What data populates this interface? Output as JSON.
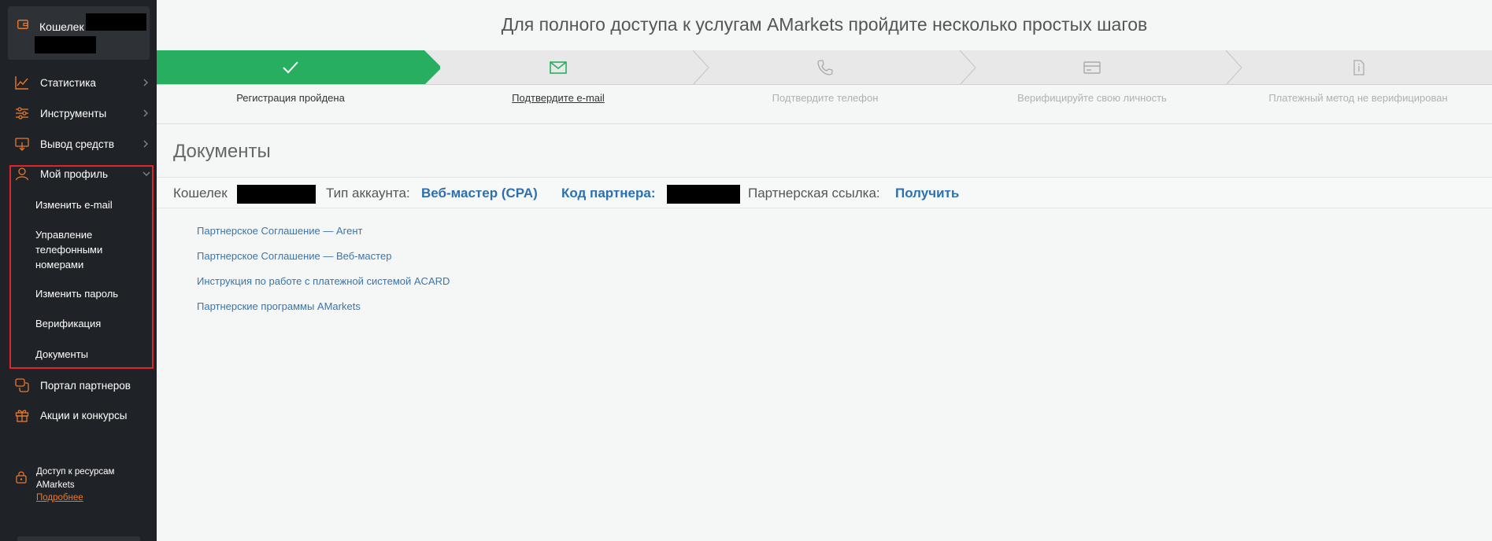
{
  "sidebar": {
    "wallet_label": "Кошелек",
    "items": [
      {
        "label": "Статистика",
        "icon": "chart-icon"
      },
      {
        "label": "Инструменты",
        "icon": "sliders-icon"
      },
      {
        "label": "Вывод средств",
        "icon": "withdraw-icon"
      },
      {
        "label": "Мой профиль",
        "icon": "user-icon"
      },
      {
        "label": "Портал партнеров",
        "icon": "chat-icon"
      },
      {
        "label": "Акции и конкурсы",
        "icon": "gift-icon"
      }
    ],
    "profile_submenu": [
      "Изменить e-mail",
      "Управление телефонными номерами",
      "Изменить пароль",
      "Верификация",
      "Документы"
    ],
    "access": {
      "text": "Доступ к ресурсам AMarkets",
      "link": "Подробнее"
    },
    "accent_color": "#e8782e",
    "highlight_color": "#e0242c"
  },
  "banner": {
    "title": "Для полного доступа к услугам AMarkets пройдите несколько простых шагов"
  },
  "steps": [
    {
      "label": "Регистрация пройдена",
      "icon": "check-icon",
      "state": "done"
    },
    {
      "label": "Подтвердите e-mail",
      "icon": "envelope-icon",
      "state": "active"
    },
    {
      "label": "Подтвердите телефон",
      "icon": "phone-icon",
      "state": "inactive"
    },
    {
      "label": "Верифицируйте свою личность",
      "icon": "card-icon",
      "state": "inactive"
    },
    {
      "label": "Платежный метод не верифицирован",
      "icon": "document-icon",
      "state": "inactive"
    }
  ],
  "page": {
    "title": "Документы",
    "info": {
      "wallet_label": "Кошелек",
      "account_type_label": "Тип аккаунта:",
      "account_type_value": "Веб-мастер (CPA)",
      "partner_code_label": "Код партнера:",
      "partner_link_label": "Партнерская ссылка:",
      "partner_link_value": "Получить"
    },
    "documents": [
      "Партнерское Соглашение — Агент",
      "Партнерское Соглашение — Веб-мастер",
      "Инструкция по работе с платежной системой ACARD",
      "Партнерские программы AMarkets"
    ]
  },
  "colors": {
    "step_done": "#27ae60",
    "link": "#3a75ac"
  }
}
